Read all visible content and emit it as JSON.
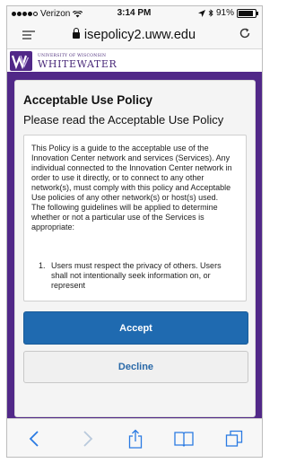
{
  "status_bar": {
    "carrier": "Verizon",
    "time": "3:14 PM",
    "battery": "91%",
    "battery_level": 0.91,
    "icons": [
      "signal-dots-icon",
      "wifi-icon",
      "location-icon",
      "bluetooth-icon",
      "battery-icon"
    ]
  },
  "browser": {
    "url": "isepolicy2.uww.edu",
    "icons": [
      "reader-icon",
      "lock-icon",
      "reload-icon"
    ]
  },
  "header": {
    "logo_small": "UNIVERSITY OF WISCONSIN",
    "logo_big": "WHITEWATER",
    "brand_color": "#512888"
  },
  "policy": {
    "title": "Acceptable Use Policy",
    "subtitle": "Please read the Acceptable Use Policy",
    "body": "This Policy is a guide to the acceptable use of the Innovation Center network and services (Services). Any individual connected to the Innovation Center  network in order to use it directly, or to connect to any other network(s), must comply with this policy and Acceptable Use policies of any other network(s) or host(s) used. The following guidelines will be applied to determine whether or not a particular use of the Services is appropriate:",
    "item_number": "1.",
    "item_text": "Users must respect the privacy of others. Users shall not intentionally seek information on, or represent"
  },
  "buttons": {
    "accept": "Accept",
    "decline": "Decline",
    "accent": "#1f6ab0"
  },
  "toolbar": {
    "icons": [
      "back-icon",
      "forward-icon",
      "share-icon",
      "bookmarks-icon",
      "tabs-icon"
    ]
  }
}
